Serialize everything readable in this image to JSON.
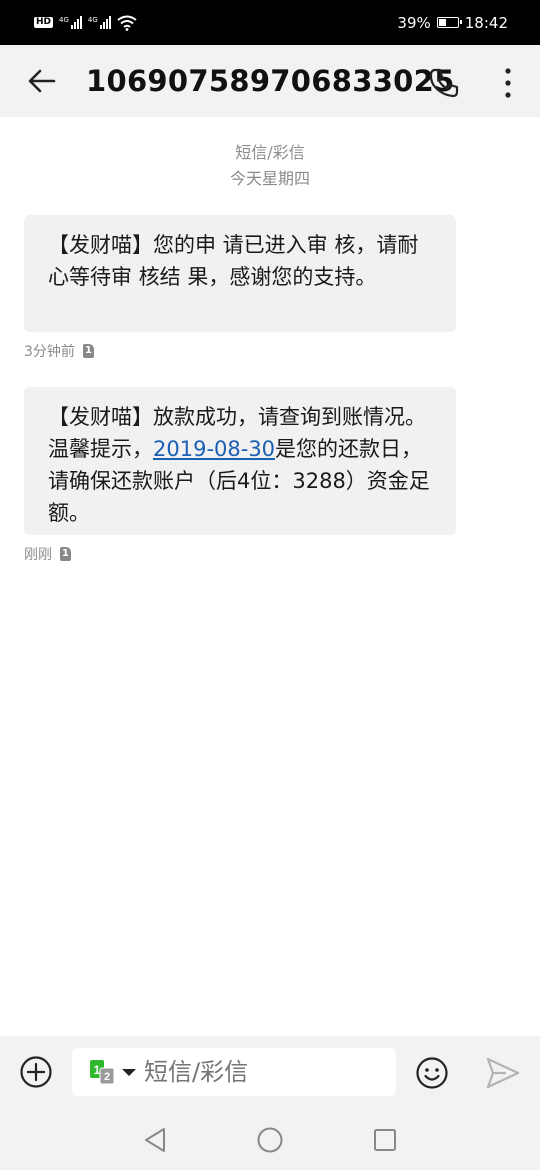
{
  "status_bar": {
    "hd_label": "HD",
    "net1_label": "4G",
    "net2_label": "4G",
    "battery_percent_text": "39%",
    "battery_level": 0.39,
    "time": "18:42"
  },
  "header": {
    "title": "106907589706833025",
    "icons": {
      "back": "back-arrow-icon",
      "call": "phone-icon",
      "more": "more-vertical-icon"
    }
  },
  "thread": {
    "type_label": "短信/彩信",
    "date_label": "今天星期四",
    "messages": [
      {
        "text": "【发财喵】您的申 请已进入审 核，请耐心等待审 核结 果，感谢您的支持。",
        "time": "3分钟前",
        "sim": "1"
      },
      {
        "text_before": "【发财喵】放款成功，请查询到账情况。温馨提示，",
        "link": "2019-08-30",
        "text_after": "是您的还款日，请确保还款账户（后4位：3288）资金足额。",
        "time": "刚刚",
        "sim": "1"
      }
    ]
  },
  "composer": {
    "placeholder": "短信/彩信",
    "sim_primary": "1",
    "sim_secondary": "2",
    "icons": {
      "add": "add-circle-icon",
      "emoji": "emoji-icon",
      "send": "send-icon"
    }
  },
  "colors": {
    "accent_link": "#1a5fb4",
    "sim_green": "#2eb82e",
    "bubble": "#f1f1f1",
    "bar_bg": "#f2f2f2"
  }
}
